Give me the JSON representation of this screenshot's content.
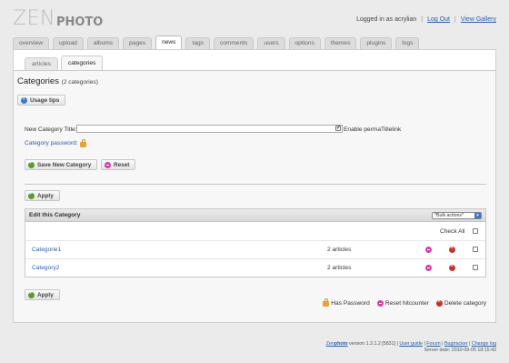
{
  "logo": {
    "part1": "ZEN",
    "part2": "PHOTO"
  },
  "user_links": {
    "logged_in_text": "Logged in as acrylian",
    "logout": "Log Out",
    "view_gallery": "View Gallery",
    "separator": "|"
  },
  "main_tabs": [
    "overview",
    "upload",
    "albums",
    "pages",
    "news",
    "tags",
    "comments",
    "users",
    "options",
    "themes",
    "plugins",
    "logs"
  ],
  "active_main_tab": "news",
  "sub_tabs": [
    "articles",
    "categories"
  ],
  "active_sub_tab": "categories",
  "page": {
    "title": "Categories",
    "subtitle": "(2 categories)",
    "usage_tips": "Usage tips"
  },
  "form": {
    "category_title_label": "New Category Title:",
    "category_title_value": "",
    "permalink_label": "Enable permaTitlelink",
    "permalink_checked": true,
    "password_label": "Category password:",
    "save_button": "Save New Category",
    "reset_button": "Reset"
  },
  "apply_label": "Apply",
  "table": {
    "heading": "Edit this Category",
    "bulk_select": "*Bulk actions*",
    "check_all_label": "Check All",
    "rows": [
      {
        "name": "Categorie1",
        "count": "2 articles"
      },
      {
        "name": "Category2",
        "count": "2 articles"
      }
    ]
  },
  "legend": {
    "has_password": "Has Password",
    "reset_hitcounter": "Reset hitcounter",
    "delete_category": "Delete category"
  },
  "footer": {
    "brand_zen": "Zen",
    "brand_photo": "photo",
    "version_text": "version 1.3.1.2 [5831]",
    "links": [
      "User guide",
      "Forum",
      "Bugtracker",
      "Change log"
    ],
    "server_date": "Server date: 2010-09-05 18:15:43"
  },
  "colors": {
    "link": "#2a5fa8",
    "page_bg": "#ebebeb",
    "panel_bg": "#f7f7f7",
    "password_icon": "#e5a531",
    "hitcounter_icon": "#d63fa8",
    "delete_icon": "#c8322b",
    "apply_icon": "#5a9b2a"
  }
}
